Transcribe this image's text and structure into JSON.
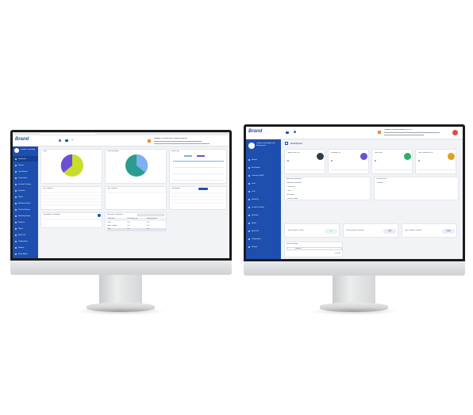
{
  "left_app": {
    "brand": "Brand",
    "company": "Lambert Technology",
    "search_label": "Go",
    "header_info": "LAMBERT TECHNOLOGY PRIVATE LIMITED",
    "sidebar_items": [
      "Dashboard",
      "Masters",
      "User Masters",
      "Transactions",
      "Location Tracking",
      "Quotation",
      "Report",
      "Marketing Report",
      "Technical Report",
      "Marketing Report",
      "Registers",
      "Report",
      "Audit Trail",
      "Configuration",
      "Settings",
      "Expire Admin"
    ],
    "panels": {
      "top_left_title": "Stock",
      "top_mid_title": "Cost Breakdown",
      "top_right_title": "Sales Flow",
      "mid_left_title": "Top Customers",
      "mid_mid_title": "Top Customers",
      "mid_right_title": "Outstanding",
      "bottom_left_title": "Outstanding Cancellation",
      "bottom_mid_title": "Item Wise Cancellation"
    },
    "table_headers": [
      "Particulars",
      "Remaining Qty",
      "Remaining Amt"
    ],
    "table_rows": [
      [
        "Cash",
        "0.00",
        "0.00"
      ],
      [
        "Bank Charges",
        "0.00",
        "0.00"
      ],
      [
        "Total",
        "0.00",
        "0.00"
      ]
    ],
    "show_entries": "Show",
    "colors": {
      "accent": "#1e4fae",
      "pie1_a": "#6b4fd3",
      "pie1_b": "#c8dc2a",
      "pie2_a": "#2a9d8f",
      "pie2_b": "#7fb0f0"
    }
  },
  "right_app": {
    "brand": "Brand",
    "company": "Lambert Technologies and Management",
    "page_title": "Dashboard",
    "header_info": "TRINERY TECHNOLOGIES PVT. LTD.",
    "sidebar_items": [
      "Masters",
      "Item Master",
      "Customer (CRM)",
      "Lead",
      "Cash",
      "Follow Up",
      "Location Tracking",
      "Quotation",
      "Report",
      "Audit Trail",
      "Configuration",
      "Settings"
    ],
    "stat_cards": [
      {
        "label": "Today's New Call",
        "value": "0",
        "color": "#2f3b47"
      },
      {
        "label": "Followup Call",
        "value": "0",
        "color": "#6b4fd3"
      },
      {
        "label": "Total Visits",
        "value": "0",
        "color": "#2fae6b"
      },
      {
        "label": "Total Technician Call",
        "value": "0",
        "color": "#e0a020"
      }
    ],
    "lists": {
      "left_title": "Attached Relevances",
      "right_title": "Technician List",
      "left_rows": [
        "Attached Document",
        "Client Note",
        "Task",
        "Activation",
        "Service Report"
      ],
      "right_rows": [
        "Location"
      ]
    },
    "revenue": [
      {
        "label": "Total Revenue ( Today )",
        "value": "0"
      },
      {
        "label": "Total Revenue ( Monthly )",
        "value": "1500"
      },
      {
        "label": "Total Tentative Revenue",
        "value": "15000"
      }
    ],
    "service_enquiry_title": "Service Enquiry",
    "service_enquiry_field": "Services",
    "view_more": "View All",
    "colors": {
      "accent": "#1e4fae"
    }
  }
}
